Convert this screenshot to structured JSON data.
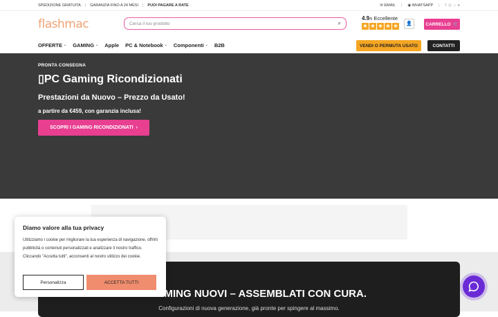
{
  "topbar": {
    "shipping": "SPEDIZIONE GRATUITA",
    "warranty": "GARANZIA FINO A 24 MESI",
    "installments": "PUOI PAGARE A RATE",
    "email": "EMAIL",
    "whatsapp": "WHATSAPP"
  },
  "header": {
    "logo": "flashmac",
    "search_placeholder": "Cerca il tuo prodotto",
    "rating_score": "4.9",
    "rating_scale": "/5",
    "rating_label": "Eccellente",
    "cart_label": "CARRELLO"
  },
  "nav": {
    "items": [
      "OFFERTE",
      "GAMING",
      "Apple",
      "PC & Notebook",
      "Componenti",
      "B2B"
    ],
    "sell_label": "VENDI O PERMUTA USATO",
    "contacts_label": "CONTATTI"
  },
  "hero": {
    "eyebrow": "PRONTA CONSEGNA",
    "title": "PC Gaming Ricondizionati",
    "subtitle": "Prestazioni da Nuovo – Prezzo da Usato!",
    "price_line": "a partire da €459, con garanzia inclusa!",
    "cta": "SCOPRI I GAMING RICONDIZIONATI"
  },
  "section": {
    "title": "PC GAMING NUOVI – ASSEMBLATI CON CURA.",
    "subtitle": "Configurazioni di nuova generazione, già pronte per spingere al massimo."
  },
  "cookie": {
    "title": "Diamo valore alla tua privacy",
    "body": "Utilizziamo i cookie per migliorare la tua esperienza di navigazione, offrirti pubblicità o contenuti personalizzati e analizzare il nostro traffico. Cliccando \"Accetta tutti\", acconsenti al nostro utilizzo dei cookie.",
    "customize": "Personalizza",
    "accept": "ACCETTA TUTTI"
  },
  "colors": {
    "accent": "#e83f91",
    "orange": "#f5a623",
    "dark": "#3a3a3a",
    "chat": "#6a2bd6"
  }
}
